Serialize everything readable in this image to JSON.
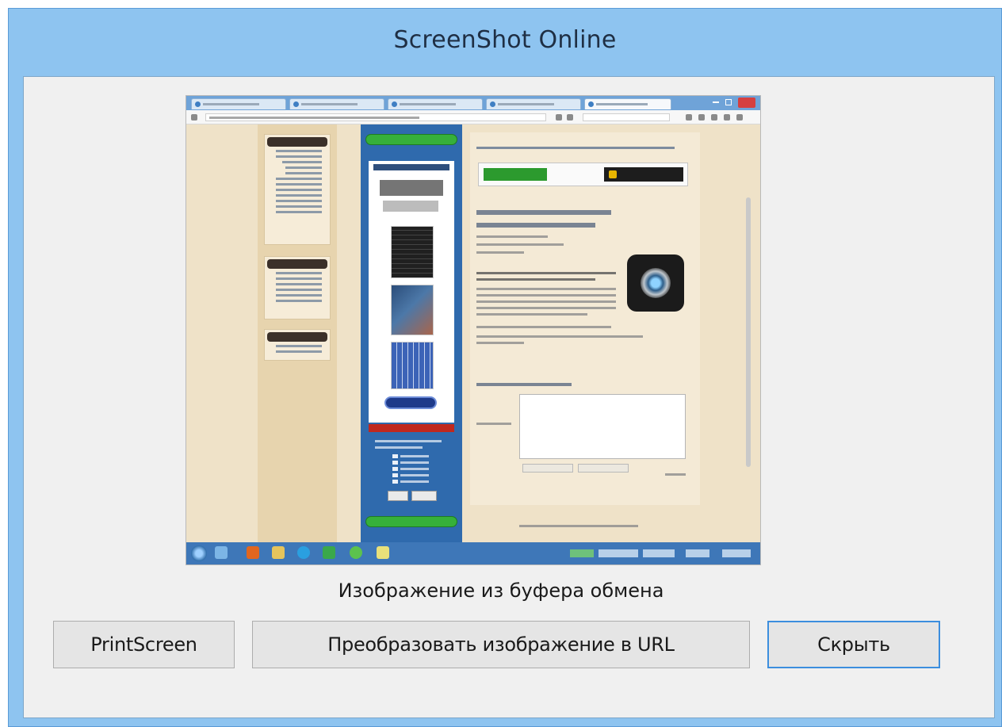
{
  "window": {
    "title": "ScreenShot Online"
  },
  "preview": {
    "caption": "Изображение из буфера обмена"
  },
  "buttons": {
    "printscreen": "PrintScreen",
    "convert": "Преобразовать изображение в URL",
    "hide": "Скрыть"
  },
  "colors": {
    "title_bar": "#8ec4f0",
    "client_area": "#f0f0f0",
    "focus_border": "#3c8ede"
  }
}
